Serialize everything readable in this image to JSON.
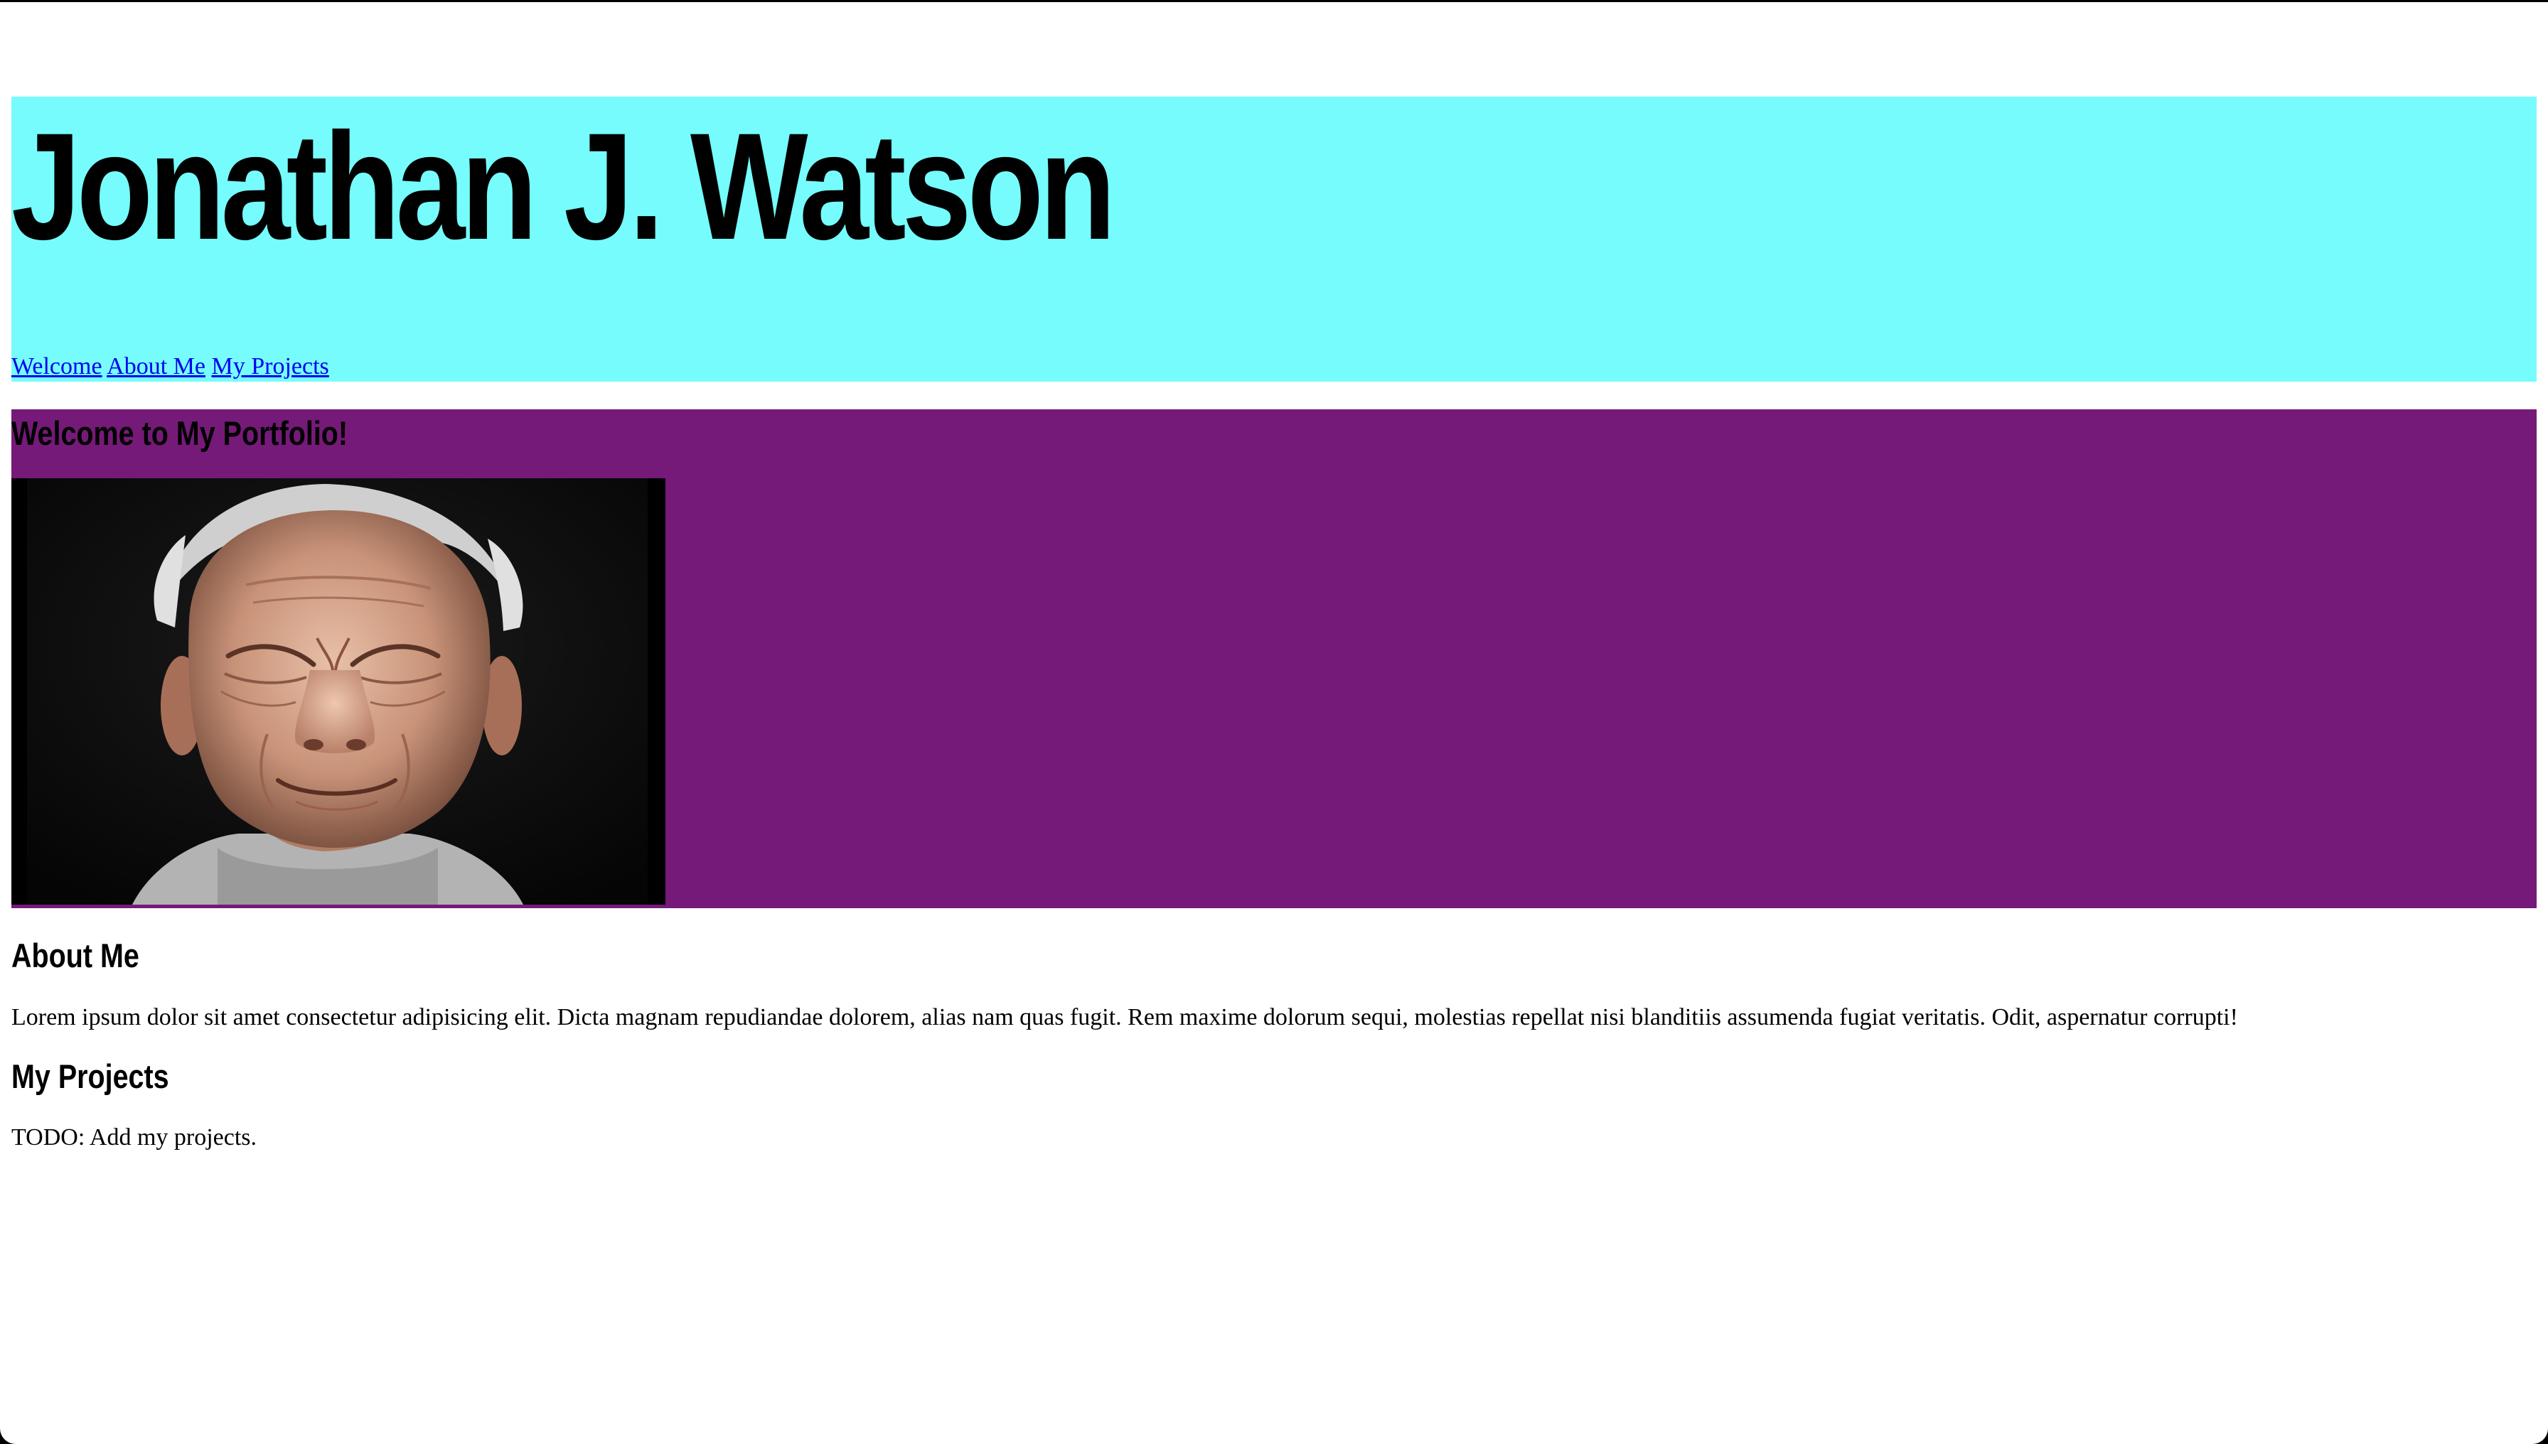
{
  "colors": {
    "header_background": "#76fcfc",
    "hero_background": "#751a78",
    "link": "#0000ee",
    "text": "#000000",
    "page_background": "#ffffff"
  },
  "header": {
    "title": "Jonathan J. Watson",
    "nav": [
      {
        "label": "Welcome"
      },
      {
        "label": "About Me"
      },
      {
        "label": "My Projects"
      }
    ]
  },
  "welcome": {
    "heading": "Welcome to My Portfolio!",
    "image_icon": "portrait-photo"
  },
  "about": {
    "heading": "About Me",
    "text": "Lorem ipsum dolor sit amet consectetur adipisicing elit. Dicta magnam repudiandae dolorem, alias nam quas fugit. Rem maxime dolorum sequi, molestias repellat nisi blanditiis assumenda fugiat veritatis. Odit, aspernatur corrupti!"
  },
  "projects": {
    "heading": "My Projects",
    "text": "TODO: Add my projects."
  }
}
